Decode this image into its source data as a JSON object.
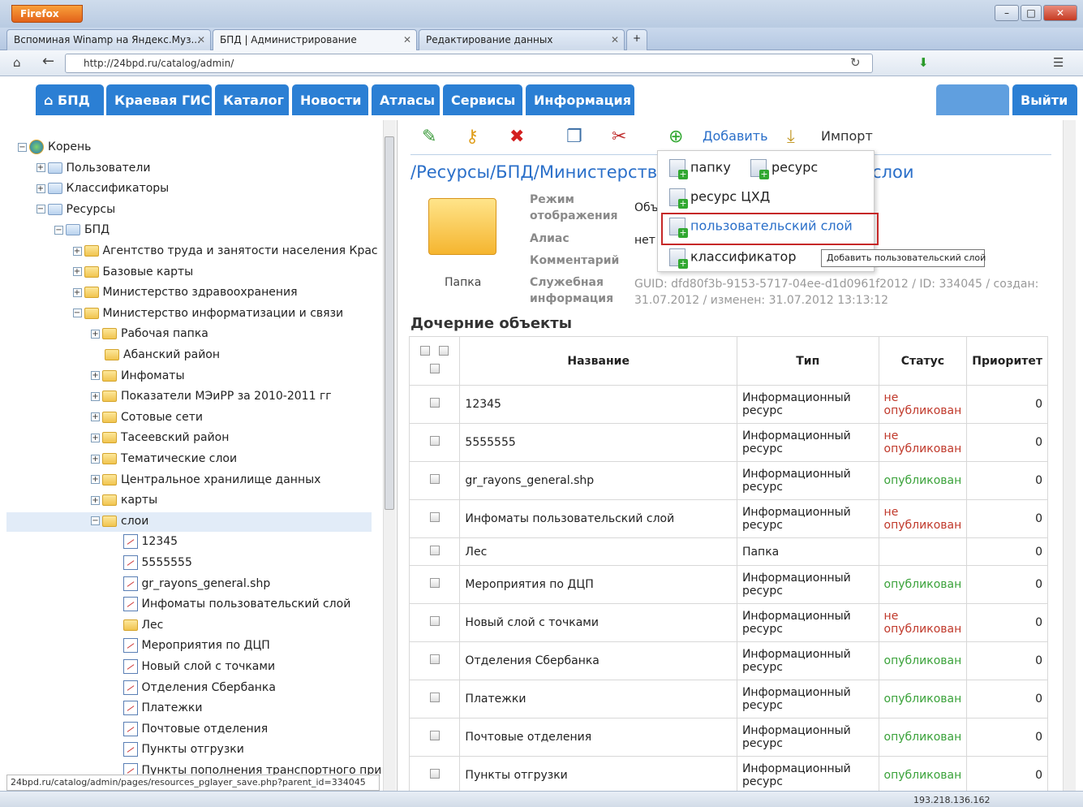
{
  "browser": {
    "button_label": "Firefox",
    "tabs": [
      {
        "label": "Вспоминая Winamp на Яндекс.Муз..."
      },
      {
        "label": "БПД | Администрирование"
      },
      {
        "label": "Редактирование данных"
      }
    ],
    "url": "http://24bpd.ru/catalog/admin/"
  },
  "site_menu": {
    "items": [
      "⌂ БПД",
      "Краевая ГИС",
      "Каталог",
      "Новости",
      "Атласы",
      "Сервисы",
      "Информация"
    ],
    "logout": "Выйти"
  },
  "tree": {
    "nodes": [
      {
        "label": "Корень",
        "depth": 0,
        "type": "root"
      },
      {
        "label": "Пользователи",
        "depth": 1,
        "type": "bluefolder"
      },
      {
        "label": "Классификаторы",
        "depth": 1,
        "type": "bluefolder"
      },
      {
        "label": "Ресурсы",
        "depth": 1,
        "type": "bluefolder"
      },
      {
        "label": "БПД",
        "depth": 2,
        "type": "bluefolder"
      },
      {
        "label": "Агентство труда и занятости населения Крас",
        "depth": 3,
        "type": "folder"
      },
      {
        "label": "Базовые карты",
        "depth": 3,
        "type": "folder"
      },
      {
        "label": "Министерство здравоохранения",
        "depth": 3,
        "type": "folder"
      },
      {
        "label": "Министерство информатизации и связи",
        "depth": 3,
        "type": "folder"
      },
      {
        "label": "Рабочая папка",
        "depth": 4,
        "type": "folder"
      },
      {
        "label": "Абанский район",
        "depth": 4,
        "type": "folder"
      },
      {
        "label": "Инфоматы",
        "depth": 4,
        "type": "folder"
      },
      {
        "label": "Показатели МЭиРР за 2010-2011 гг",
        "depth": 4,
        "type": "folder"
      },
      {
        "label": "Сотовые сети",
        "depth": 4,
        "type": "folder"
      },
      {
        "label": "Тасеевский район",
        "depth": 4,
        "type": "folder"
      },
      {
        "label": "Тематические слои",
        "depth": 4,
        "type": "folder"
      },
      {
        "label": "Центральное хранилище данных",
        "depth": 4,
        "type": "folder"
      },
      {
        "label": "карты",
        "depth": 4,
        "type": "folder"
      },
      {
        "label": "слои",
        "depth": 4,
        "type": "folder",
        "selected": true
      },
      {
        "label": "12345",
        "depth": 5,
        "type": "layer"
      },
      {
        "label": "5555555",
        "depth": 5,
        "type": "layer"
      },
      {
        "label": "gr_rayons_general.shp",
        "depth": 5,
        "type": "layer"
      },
      {
        "label": "Инфоматы пользовательский слой",
        "depth": 5,
        "type": "layer"
      },
      {
        "label": "Лес",
        "depth": 5,
        "type": "folder"
      },
      {
        "label": "Мероприятия по ДЦП",
        "depth": 5,
        "type": "layer"
      },
      {
        "label": "Новый слой с точками",
        "depth": 5,
        "type": "layer"
      },
      {
        "label": "Отделения Сбербанка",
        "depth": 5,
        "type": "layer"
      },
      {
        "label": "Платежки",
        "depth": 5,
        "type": "layer"
      },
      {
        "label": "Почтовые отделения",
        "depth": 5,
        "type": "layer"
      },
      {
        "label": "Пункты отгрузки",
        "depth": 5,
        "type": "layer"
      },
      {
        "label": "Пункты пополнения транспортного при",
        "depth": 5,
        "type": "layer"
      }
    ]
  },
  "status_url": "24bpd.ru/catalog/admin/pages/resources_pglayer_save.php?parent_id=334045",
  "toolbar": {
    "add_label": "Добавить",
    "import_label": "Импорт"
  },
  "breadcrumb": "/Ресурсы/БПД/Министерство",
  "breadcrumb_tail": "/слои",
  "folder_label": "Папка",
  "props": {
    "mode_label": "Режим отображения",
    "mode_value": "Объ",
    "alias_label": "Алиас",
    "alias_value": "нет",
    "comment_label": "Комментарий",
    "service_label": "Служебная информация",
    "service_value": "GUID: dfd80f3b-9153-5717-04ee-d1d0961f2012 / ID: 334045 / создан: 31.07.2012 / изменен: 31.07.2012 13:13:12"
  },
  "children_header": "Дочерние объекты",
  "table": {
    "headers": [
      "Название",
      "Тип",
      "Статус",
      "Приоритет"
    ],
    "rows": [
      {
        "name": "12345",
        "type": "Информационный ресурс",
        "status": "не опубликован",
        "published": false,
        "priority": "0"
      },
      {
        "name": "5555555",
        "type": "Информационный ресурс",
        "status": "не опубликован",
        "published": false,
        "priority": "0"
      },
      {
        "name": "gr_rayons_general.shp",
        "type": "Информационный ресурс",
        "status": "опубликован",
        "published": true,
        "priority": "0"
      },
      {
        "name": "Инфоматы пользовательский слой",
        "type": "Информационный ресурс",
        "status": "не опубликован",
        "published": false,
        "priority": "0"
      },
      {
        "name": "Лес",
        "type": "Папка",
        "status": "",
        "published": null,
        "priority": "0"
      },
      {
        "name": "Мероприятия по ДЦП",
        "type": "Информационный ресурс",
        "status": "опубликован",
        "published": true,
        "priority": "0"
      },
      {
        "name": "Новый слой с точками",
        "type": "Информационный ресурс",
        "status": "не опубликован",
        "published": false,
        "priority": "0"
      },
      {
        "name": "Отделения Сбербанка",
        "type": "Информационный ресурс",
        "status": "опубликован",
        "published": true,
        "priority": "0"
      },
      {
        "name": "Платежки",
        "type": "Информационный ресурс",
        "status": "опубликован",
        "published": true,
        "priority": "0"
      },
      {
        "name": "Почтовые отделения",
        "type": "Информационный ресурс",
        "status": "опубликован",
        "published": true,
        "priority": "0"
      },
      {
        "name": "Пункты отгрузки",
        "type": "Информационный ресурс",
        "status": "опубликован",
        "published": true,
        "priority": "0"
      }
    ]
  },
  "dropdown": {
    "folder": "папку",
    "resource": "ресурс",
    "resource_chd": "ресурс ЦХД",
    "user_layer": "пользовательский слой",
    "classifier": "классификатор"
  },
  "tooltip": "Добавить пользовательский слой",
  "ip_address": "193.218.136.162",
  "colors": {
    "menu_blue": "#2b7fd4",
    "link_blue": "#2a6fc9",
    "published": "#3aa23a",
    "unpublished": "#c0392b",
    "highlight": "#c62828"
  }
}
